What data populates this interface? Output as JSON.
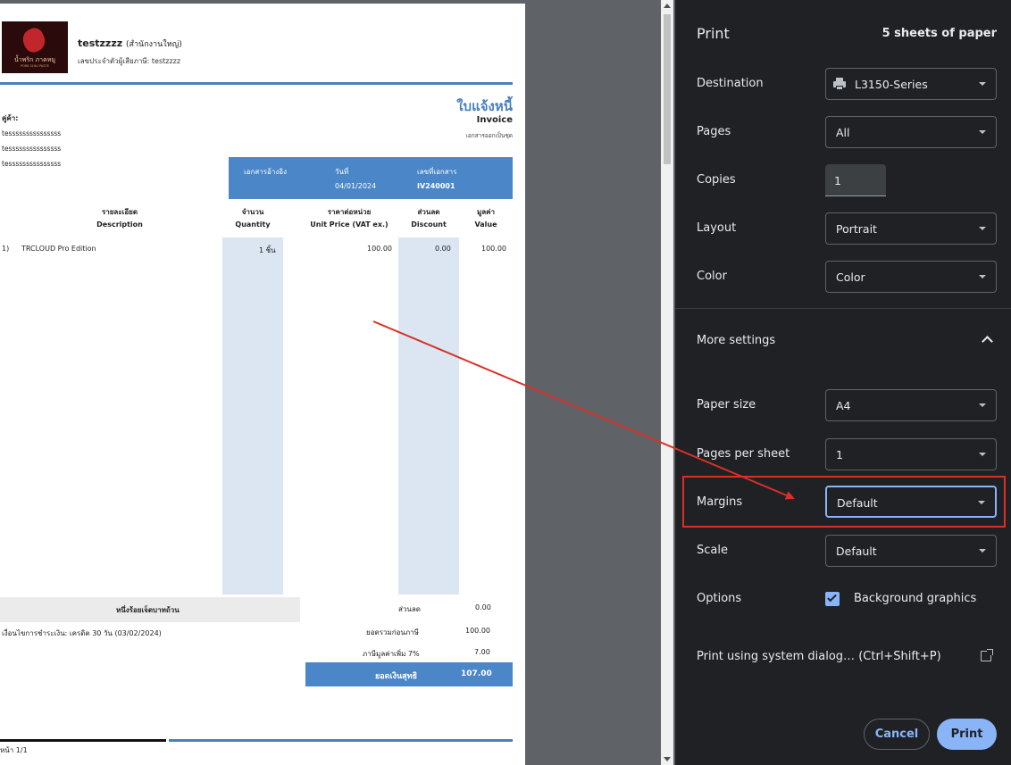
{
  "invoice": {
    "company_name": "testzzzz",
    "company_branch": "(สำนักงานใหญ่)",
    "tax_id": "เลขประจำตัวผู้เสียภาษี: testzzzz",
    "logo_text": "น้ำพริก ภาคหมู",
    "logo_subtext": "PORK CHILI PASTE",
    "doc_title_th": "ใบแจ้งหนี้",
    "doc_title_en": "Invoice",
    "doc_note": "เอกสารออกเป็นชุด",
    "customer_label": "คู่ค้า:",
    "customer_lines": [
      "tesssssssssssssss",
      "tesssssssssssssss",
      "tesssssssssssssss"
    ],
    "ref": {
      "ref_label": "เอกสารอ้างอิง",
      "date_label": "วันที่",
      "date_value": "04/01/2024",
      "docno_label": "เลขที่เอกสาร",
      "docno_value": "IV240001"
    },
    "columns": [
      {
        "th": "รายละเอียด",
        "en": "Description"
      },
      {
        "th": "จำนวน",
        "en": "Quantity"
      },
      {
        "th": "ราคาต่อหน่วย",
        "en": "Unit Price (VAT ex.)"
      },
      {
        "th": "ส่วนลด",
        "en": "Discount"
      },
      {
        "th": "มูลค่า",
        "en": "Value"
      }
    ],
    "items": [
      {
        "no": "1)",
        "description": "TRCLOUD Pro Edition",
        "quantity": "1 ชิ้น",
        "unit_price": "100.00",
        "discount": "0.00",
        "value": "100.00"
      }
    ],
    "amount_words": "หนึ่งร้อยเจ็ดบาทถ้วน",
    "payment_terms": "เงื่อนไขการชำระเงิน: เครดิต 30 วัน (03/02/2024)",
    "summary": [
      {
        "label": "ส่วนลด",
        "value": "0.00"
      },
      {
        "label": "ยอดรวมก่อนภาษี",
        "value": "100.00"
      },
      {
        "label": "ภาษีมูลค่าเพิ่ม 7%",
        "value": "7.00"
      }
    ],
    "net_label": "ยอดเงินสุทธิ",
    "net_value": "107.00",
    "page_no": "หน้า 1/1"
  },
  "panel": {
    "title": "Print",
    "sheets": "5 sheets of paper",
    "destination_label": "Destination",
    "destination_value": "L3150-Series",
    "pages_label": "Pages",
    "pages_value": "All",
    "copies_label": "Copies",
    "copies_value": "1",
    "layout_label": "Layout",
    "layout_value": "Portrait",
    "color_label": "Color",
    "color_value": "Color",
    "more_settings_label": "More settings",
    "paper_size_label": "Paper size",
    "paper_size_value": "A4",
    "pages_per_sheet_label": "Pages per sheet",
    "pages_per_sheet_value": "1",
    "margins_label": "Margins",
    "margins_value": "Default",
    "scale_label": "Scale",
    "scale_value": "Default",
    "options_label": "Options",
    "background_graphics_label": "Background graphics",
    "system_dialog_label": "Print using system dialog… (Ctrl+Shift+P)",
    "cancel_label": "Cancel",
    "print_label": "Print"
  },
  "colors": {
    "accent": "#8ab4f8",
    "panel_bg": "#202124",
    "annotation_red": "#d93025",
    "invoice_blue": "#4a86c8"
  },
  "icons": [
    "printer-icon",
    "chevron-down-icon",
    "chevron-up-icon",
    "checkbox-checked-icon",
    "open-in-new-icon"
  ]
}
